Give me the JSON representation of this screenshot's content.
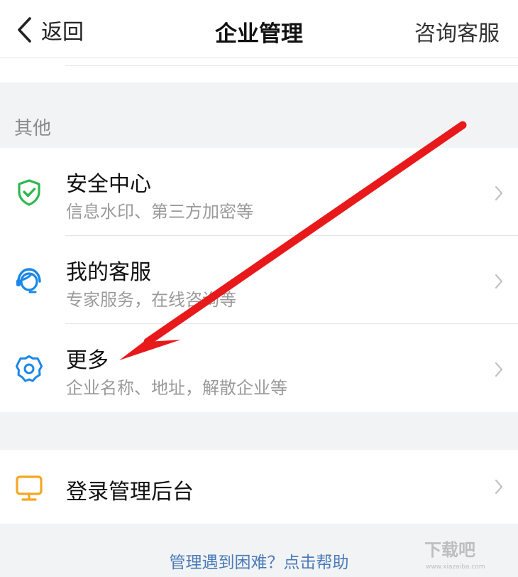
{
  "navbar": {
    "back_label": "返回",
    "title": "企业管理",
    "right_action": "咨询客服"
  },
  "section_other": {
    "label": "其他"
  },
  "items": [
    {
      "title": "安全中心",
      "subtitle": "信息水印、第三方加密等",
      "icon": "shield-check-icon",
      "icon_color": "#2db84d"
    },
    {
      "title": "我的客服",
      "subtitle": "专家服务，在线咨询等",
      "icon": "customer-service-icon",
      "icon_color": "#1a88e8"
    },
    {
      "title": "更多",
      "subtitle": "企业名称、地址，解散企业等",
      "icon": "gear-icon",
      "icon_color": "#1a88e8"
    }
  ],
  "admin": {
    "title": "登录管理后台",
    "icon": "monitor-icon",
    "icon_color": "#f5a623"
  },
  "footer": {
    "help_link": "管理遇到困难？点击帮助"
  },
  "watermark": {
    "text": "下载吧",
    "url": "www.xiazaiba.com"
  },
  "annotation": {
    "color": "#e8191b"
  }
}
